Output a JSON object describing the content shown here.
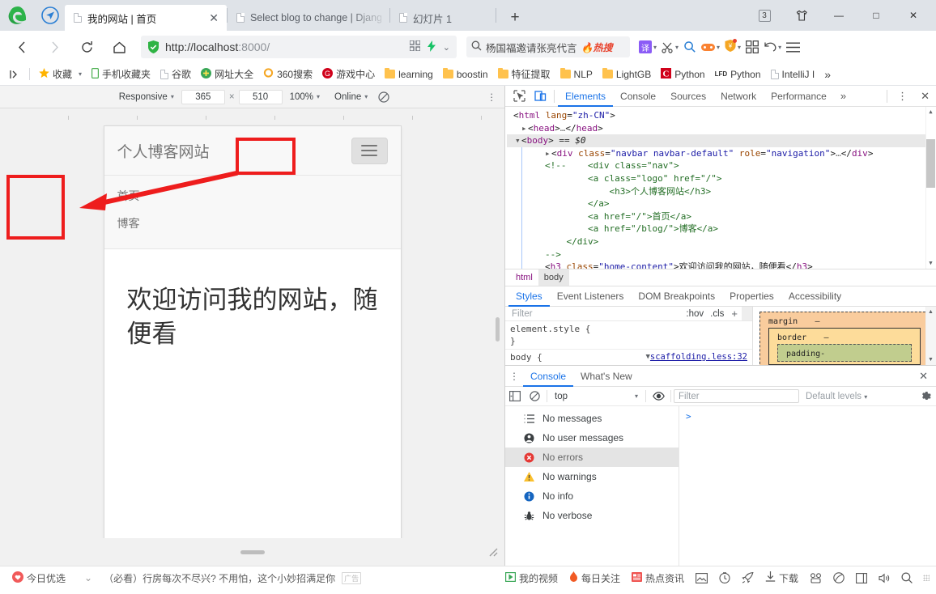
{
  "browser": {
    "tabs": [
      {
        "title": "我的网站 | 首页",
        "active": true,
        "closable": true
      },
      {
        "title": "Select blog to change | Djang",
        "active": false,
        "closable": false
      },
      {
        "title": "幻灯片 1",
        "active": false,
        "closable": false
      }
    ],
    "new_tab_label": "+",
    "tab_count_badge": "3",
    "window_controls": {
      "minimize": "—",
      "maximize": "□",
      "close": "✕"
    },
    "nav": {
      "back": "‹",
      "forward": "›",
      "reload": "⟳",
      "home": "⌂",
      "url": "http://localhost:8000/",
      "url_protocol": "http://",
      "url_host": "localhost",
      "url_port": ":8000/",
      "qr_icon": "qr-icon",
      "lightning_icon": "lightning-icon",
      "chevron": "⌄"
    },
    "search": {
      "placeholder": "杨国福邀请张亮代言",
      "hot_label": "热搜"
    },
    "toolbar_icons": [
      "translate-icon",
      "scissors-icon",
      "magnifier-icon",
      "gamepad-icon",
      "shield-badge-icon",
      "apps-grid-icon",
      "undo-icon",
      "menu-icon"
    ]
  },
  "bookmarks": {
    "expand_icon": "⏵",
    "items": [
      {
        "label": "收藏",
        "icon": "star-icon"
      },
      {
        "label": "手机收藏夹",
        "icon": "phone-icon"
      },
      {
        "label": "谷歌",
        "icon": "page-icon"
      },
      {
        "label": "网址大全",
        "icon": "green-plus-icon"
      },
      {
        "label": "360搜索",
        "icon": "orange-ring-icon"
      },
      {
        "label": "游戏中心",
        "icon": "red-circle-icon"
      },
      {
        "label": "learning",
        "icon": "folder-icon"
      },
      {
        "label": "boostin",
        "icon": "folder-icon"
      },
      {
        "label": "特征提取",
        "icon": "folder-icon"
      },
      {
        "label": "NLP",
        "icon": "folder-icon"
      },
      {
        "label": "LightGB",
        "icon": "folder-icon"
      },
      {
        "label": "Python",
        "icon": "c-red-icon"
      },
      {
        "label": "Python",
        "icon": "lfd-icon"
      },
      {
        "label": "IntelliJ I",
        "icon": "page-icon"
      }
    ],
    "overflow": "»"
  },
  "device_toolbar": {
    "device": "Responsive",
    "width": "365",
    "x_symbol": "×",
    "height": "510",
    "zoom": "100%",
    "throttle": "Online",
    "no_throttle_icon": "no-throttling-icon",
    "more_icon": "⋮"
  },
  "page_preview": {
    "site_title": "个人博客网站",
    "hamburger_icon": "hamburger-icon",
    "nav_links": [
      "首页",
      "博客"
    ],
    "home_content": "欢迎访问我的网站，随便看"
  },
  "devtools": {
    "inspect_icon": "inspect-icon",
    "device_icon": "device-toolbar-icon",
    "tabs": [
      "Elements",
      "Console",
      "Sources",
      "Network",
      "Performance"
    ],
    "active_tab": "Elements",
    "overflow": "»",
    "more_icon": "⋮",
    "close_icon": "✕",
    "elements_lines": [
      {
        "indent": 0,
        "html": "&lt;<span class=\"tagc\">html</span> <span class=\"attrn\">lang</span>=<span class=\"attrv\">\"zh-CN\"</span>&gt;"
      },
      {
        "indent": 1,
        "html": "<span class=\"arrow-t\">▸</span>&lt;<span class=\"tagc\">head</span>&gt;<span class=\"dots3\">…</span>&lt;/<span class=\"tagc\">head</span>&gt;"
      },
      {
        "indent": 1,
        "html": "<span class=\"arrow-t\">▾</span>&lt;<span class=\"tagc\">body</span>&gt; == <span style=\"font-style:italic\">$0</span>"
      },
      {
        "indent": 2,
        "html": "<span class=\"arrow-t\">▸</span>&lt;<span class=\"tagc\">div</span> <span class=\"attrn\">class</span>=<span class=\"attrv\">\"navbar navbar-default\"</span> <span class=\"attrn\">role</span>=<span class=\"attrv\">\"navigation\"</span>&gt;<span class=\"dots3\">…</span>&lt;/<span class=\"tagc\">div</span>&gt;"
      },
      {
        "indent": 2,
        "html": "<span class=\"cmt\">&lt;!--    &lt;div class=\"nav\"&gt;</span>"
      },
      {
        "indent": 2,
        "html": "<span class=\"cmt\">        &lt;a class=\"logo\" href=\"/\"&gt;</span>"
      },
      {
        "indent": 2,
        "html": "<span class=\"cmt\">            &lt;h3&gt;个人博客网站&lt;/h3&gt;</span>"
      },
      {
        "indent": 2,
        "html": "<span class=\"cmt\">        &lt;/a&gt;</span>"
      },
      {
        "indent": 2,
        "html": "<span class=\"cmt\">        &lt;a href=\"/\"&gt;首页&lt;/a&gt;</span>"
      },
      {
        "indent": 2,
        "html": "<span class=\"cmt\">        &lt;a href=\"/blog/\"&gt;博客&lt;/a&gt;</span>"
      },
      {
        "indent": 2,
        "html": "<span class=\"cmt\">    &lt;/div&gt;</span>"
      },
      {
        "indent": 2,
        "html": "<span class=\"cmt\">--&gt;</span>"
      },
      {
        "indent": 2,
        "html": "&lt;<span class=\"tagc\">h3</span> <span class=\"attrn\">class</span>=<span class=\"attrv\">\"home-content\"</span>&gt;<span class=\"txtc\">欢迎访问我的网站，随便看</span>&lt;/<span class=\"tagc\">h3</span>&gt;"
      }
    ],
    "breadcrumbs": [
      "html",
      "body"
    ],
    "styles_tabs": [
      "Styles",
      "Event Listeners",
      "DOM Breakpoints",
      "Properties",
      "Accessibility"
    ],
    "styles_active": "Styles",
    "filter_placeholder": "Filter",
    "hov_label": ":hov",
    "cls_label": ".cls",
    "plus_label": "+",
    "rules": [
      {
        "selector": "element.style {",
        "close": "}",
        "source": ""
      },
      {
        "selector": "body {",
        "close": "",
        "source": "scaffolding.less:32"
      }
    ],
    "box_model": {
      "margin": "margin",
      "margin_val": "–",
      "border": "border",
      "border_val": "–",
      "padding": "padding-"
    }
  },
  "console": {
    "tabs": [
      "Console",
      "What's New"
    ],
    "active_tab": "Console",
    "close_icon": "✕",
    "more_icon": "⋮",
    "sidebar_toggle_icon": "sidebar-toggle-icon",
    "clear_icon": "clear-console-icon",
    "context": "top",
    "eye_icon": "eye-icon",
    "filter_placeholder": "Filter",
    "levels": "Default levels",
    "gear_icon": "settings-gear-icon",
    "counts": [
      {
        "label": "No messages",
        "icon": "list-icon",
        "selected": false
      },
      {
        "label": "No user messages",
        "icon": "user-icon",
        "selected": false
      },
      {
        "label": "No errors",
        "icon": "error-icon",
        "selected": true
      },
      {
        "label": "No warnings",
        "icon": "warning-icon",
        "selected": false
      },
      {
        "label": "No info",
        "icon": "info-icon",
        "selected": false
      },
      {
        "label": "No verbose",
        "icon": "bug-icon",
        "selected": false
      }
    ],
    "prompt": ">"
  },
  "taskbar": {
    "left": {
      "label": "今日优选",
      "icon": "heart-icon",
      "expand": "⌄"
    },
    "ad": "（必看）行房每次不尽兴? 不用怕，这个小妙招满足你",
    "ad_tag": "广告",
    "right_items": [
      {
        "label": "我的视频",
        "icon": "video-icon"
      },
      {
        "label": "每日关注",
        "icon": "flame-icon"
      },
      {
        "label": "热点资讯",
        "icon": "news-icon"
      },
      {
        "label": "",
        "icon": "image-icon"
      },
      {
        "label": "",
        "icon": "clock-icon"
      },
      {
        "label": "",
        "icon": "rocket-icon"
      },
      {
        "label": "下载",
        "icon": "download-icon"
      },
      {
        "label": "",
        "icon": "print-icon"
      },
      {
        "label": "",
        "icon": "shield-scan-icon"
      },
      {
        "label": "",
        "icon": "window-icon"
      },
      {
        "label": "",
        "icon": "volume-icon"
      },
      {
        "label": "",
        "icon": "search-icon"
      }
    ]
  },
  "colors": {
    "annotation_red": "#ee1d1d",
    "devtools_accent": "#1a73e8",
    "tabstrip_bg": "#dfe3e8"
  }
}
